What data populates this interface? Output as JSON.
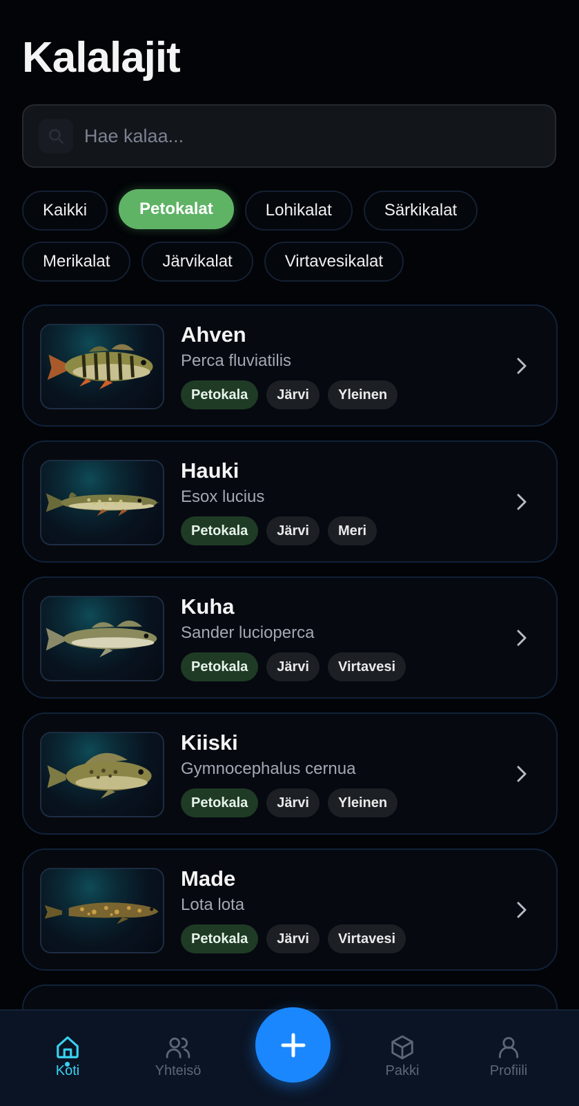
{
  "page": {
    "title": "Kalalajit"
  },
  "search": {
    "placeholder": "Hae kalaa..."
  },
  "filters": [
    {
      "label": "Kaikki",
      "active": false
    },
    {
      "label": "Petokalat",
      "active": true
    },
    {
      "label": "Lohikalat",
      "active": false
    },
    {
      "label": "Särkikalat",
      "active": false
    },
    {
      "label": "Merikalat",
      "active": false
    },
    {
      "label": "Järvikalat",
      "active": false
    },
    {
      "label": "Virtavesikalat",
      "active": false
    }
  ],
  "fish": [
    {
      "name": "Ahven",
      "latin": "Perca fluviatilis",
      "tags": [
        "Petokala",
        "Järvi",
        "Yleinen"
      ]
    },
    {
      "name": "Hauki",
      "latin": "Esox lucius",
      "tags": [
        "Petokala",
        "Järvi",
        "Meri"
      ]
    },
    {
      "name": "Kuha",
      "latin": "Sander lucioperca",
      "tags": [
        "Petokala",
        "Järvi",
        "Virtavesi"
      ]
    },
    {
      "name": "Kiiski",
      "latin": "Gymnocephalus cernua",
      "tags": [
        "Petokala",
        "Järvi",
        "Yleinen"
      ]
    },
    {
      "name": "Made",
      "latin": "Lota lota",
      "tags": [
        "Petokala",
        "Järvi",
        "Virtavesi"
      ]
    }
  ],
  "nav": {
    "items": [
      {
        "label": "Koti",
        "icon": "home-icon",
        "active": true
      },
      {
        "label": "Yhteisö",
        "icon": "users-icon",
        "active": false
      },
      {
        "label": "Pakki",
        "icon": "box-icon",
        "active": false
      },
      {
        "label": "Profiili",
        "icon": "user-icon",
        "active": false
      }
    ],
    "fab_icon": "plus-icon"
  },
  "colors": {
    "background": "#020408",
    "accent_green": "#5fb365",
    "accent_cyan": "#39d2f0",
    "fab_blue": "#1a87ff",
    "tag_green_bg": "#1f3b26"
  }
}
